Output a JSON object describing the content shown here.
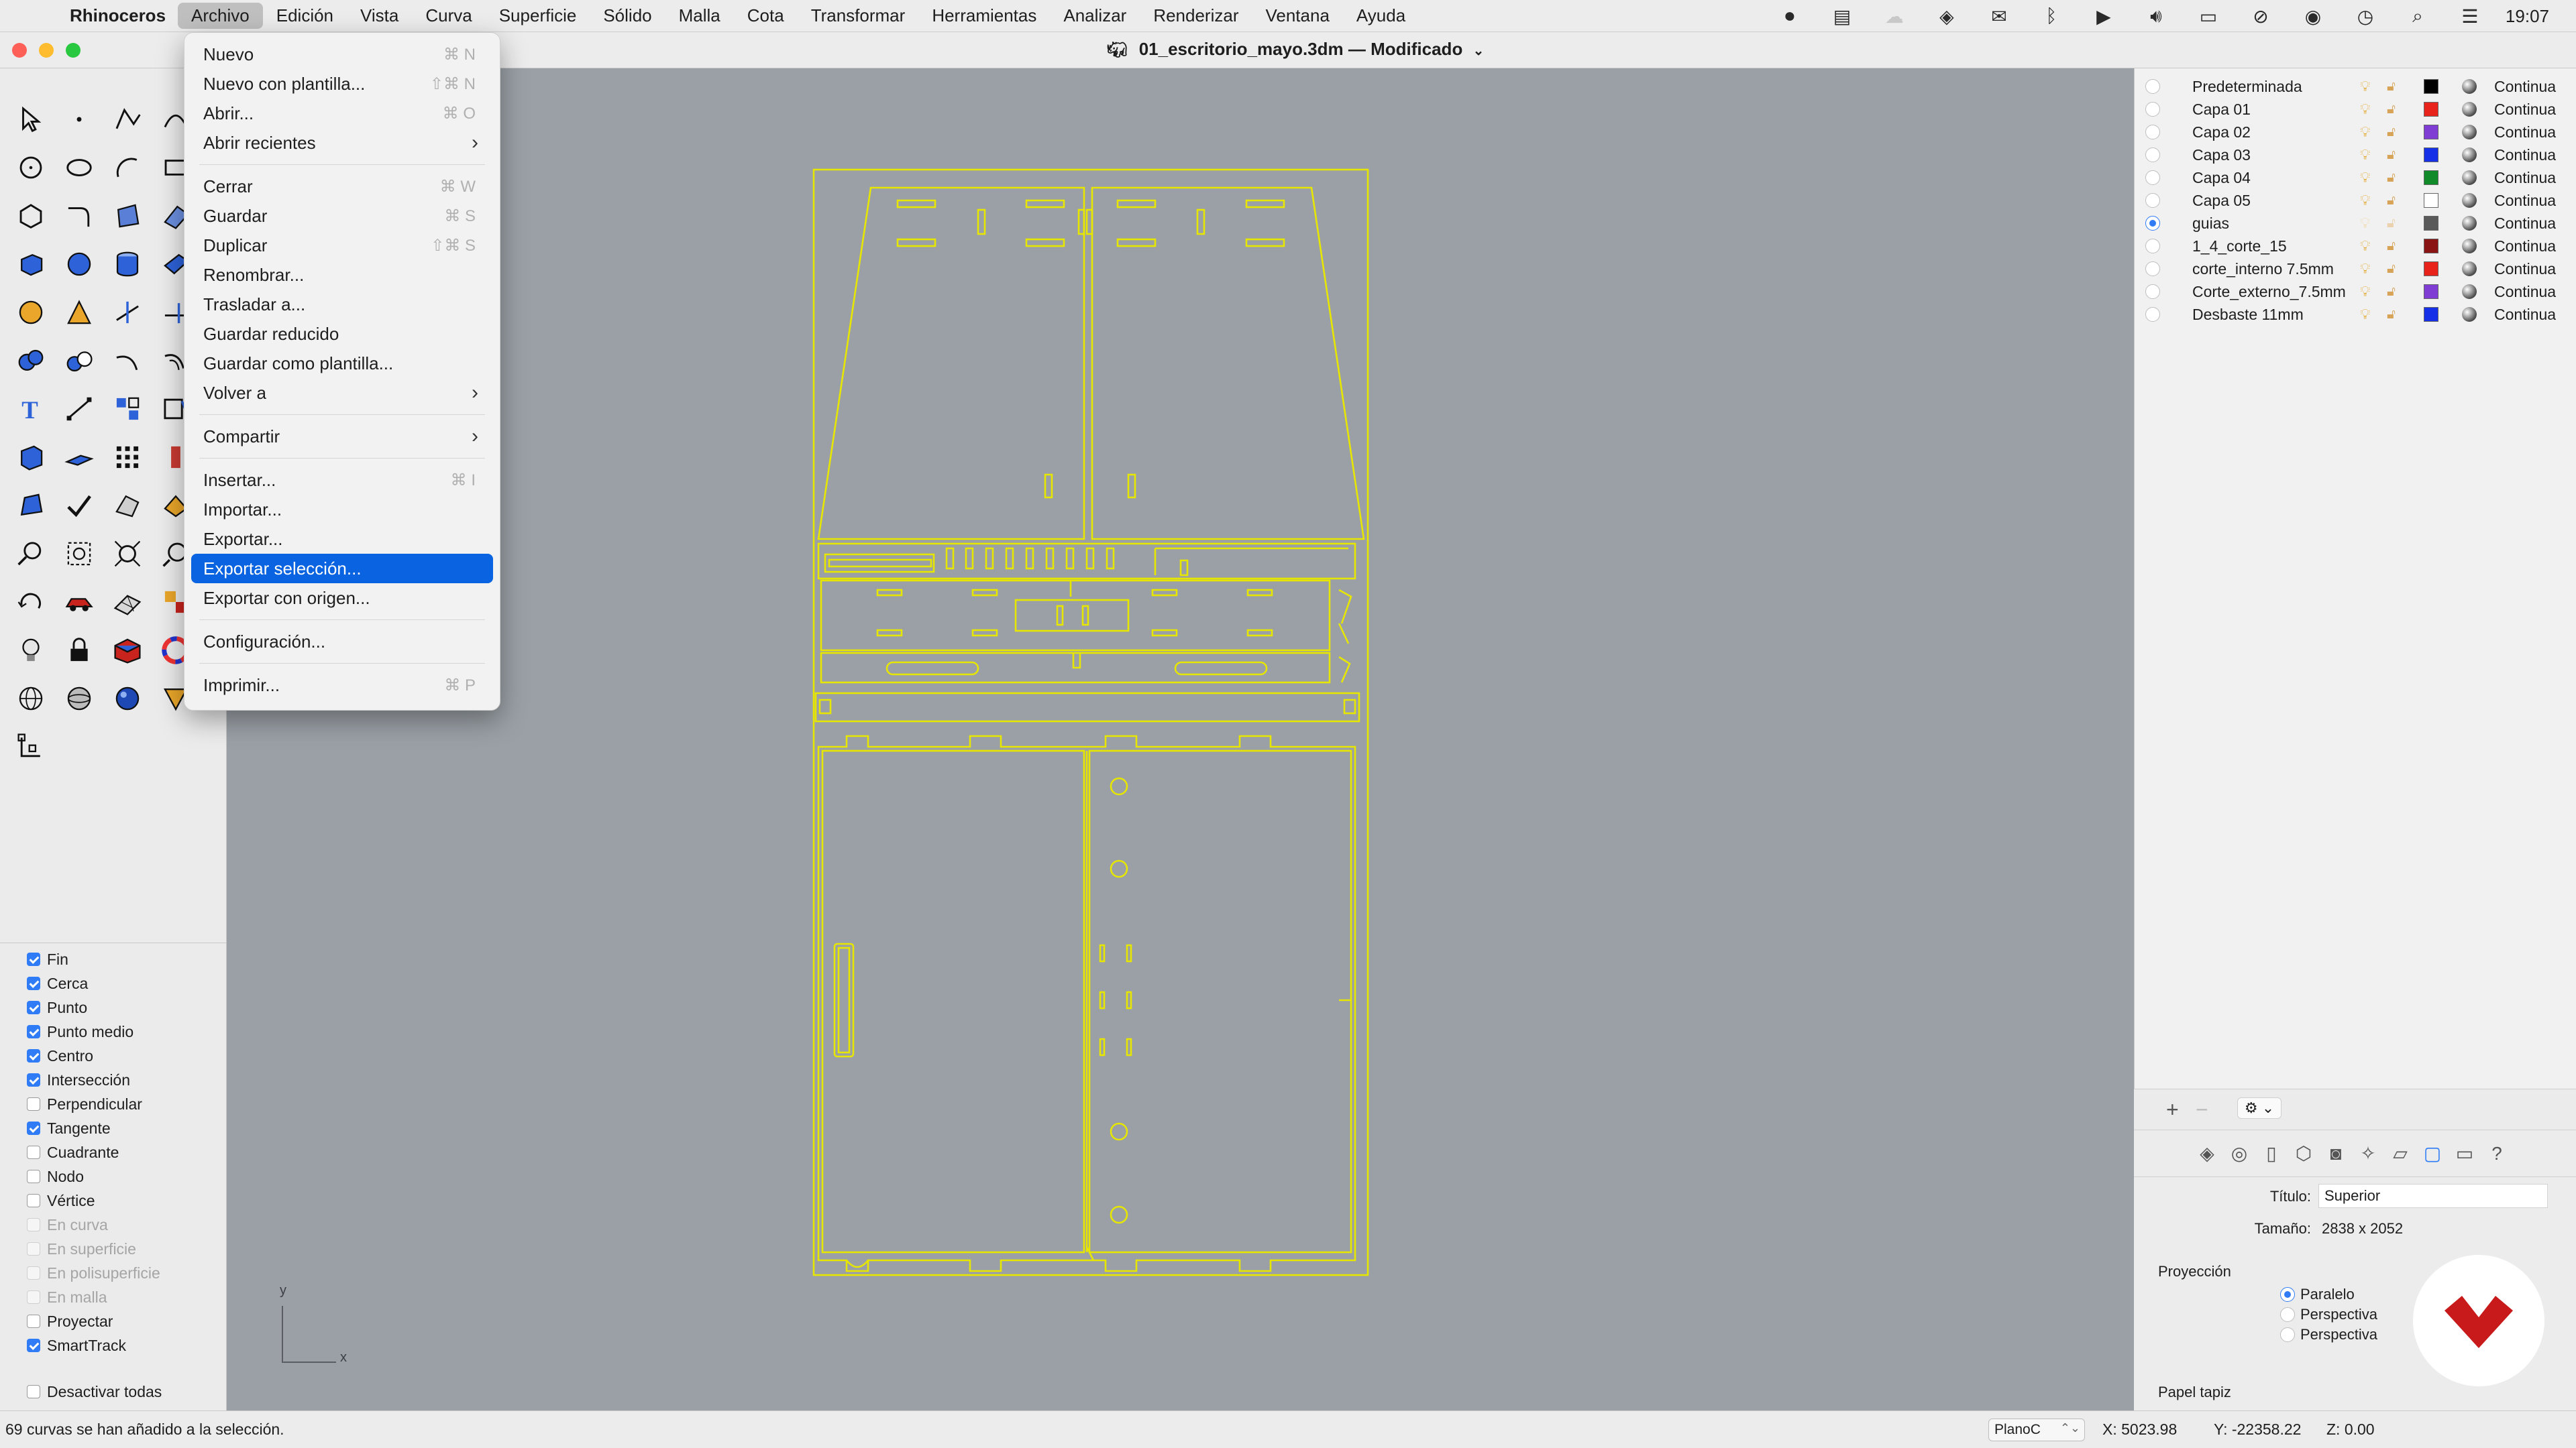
{
  "menubar": {
    "app_name": "Rhinoceros",
    "items": [
      "Archivo",
      "Edición",
      "Vista",
      "Curva",
      "Superficie",
      "Sólido",
      "Malla",
      "Cota",
      "Transformar",
      "Herramientas",
      "Analizar",
      "Renderizar",
      "Ventana",
      "Ayuda"
    ],
    "active_item": "Archivo",
    "clock": "19:07",
    "status_icons": [
      "record-icon",
      "notes-icon",
      "cloud-icon",
      "dropbox-icon",
      "mail-icon",
      "bluetooth-icon",
      "play-icon",
      "volume-icon",
      "battery-icon",
      "wifi-off-icon",
      "user-icon",
      "time-machine-icon",
      "search-icon",
      "control-center-icon"
    ]
  },
  "window": {
    "title": "01_escritorio_mayo.3dm",
    "separator": "—",
    "state": "Modificado"
  },
  "file_menu": {
    "items": [
      {
        "label": "Nuevo",
        "shortcut": "⌘ N"
      },
      {
        "label": "Nuevo con plantilla...",
        "shortcut": "⇧⌘ N"
      },
      {
        "label": "Abrir...",
        "shortcut": "⌘ O"
      },
      {
        "label": "Abrir recientes",
        "submenu": true
      },
      {
        "separator": true
      },
      {
        "label": "Cerrar",
        "shortcut": "⌘ W"
      },
      {
        "label": "Guardar",
        "shortcut": "⌘ S"
      },
      {
        "label": "Duplicar",
        "shortcut": "⇧⌘ S"
      },
      {
        "label": "Renombrar..."
      },
      {
        "label": "Trasladar a..."
      },
      {
        "label": "Guardar reducido"
      },
      {
        "label": "Guardar como plantilla..."
      },
      {
        "label": "Volver a",
        "submenu": true
      },
      {
        "separator": true
      },
      {
        "label": "Compartir",
        "submenu": true
      },
      {
        "separator": true
      },
      {
        "label": "Insertar...",
        "shortcut": "⌘ I"
      },
      {
        "label": "Importar..."
      },
      {
        "label": "Exportar..."
      },
      {
        "label": "Exportar selección...",
        "highlighted": true
      },
      {
        "label": "Exportar con origen..."
      },
      {
        "separator": true
      },
      {
        "label": "Configuración..."
      },
      {
        "separator": true
      },
      {
        "label": "Imprimir...",
        "shortcut": "⌘ P"
      }
    ]
  },
  "osnaps": {
    "items": [
      {
        "label": "Fin",
        "checked": true
      },
      {
        "label": "Cerca",
        "checked": true
      },
      {
        "label": "Punto",
        "checked": true
      },
      {
        "label": "Punto medio",
        "checked": true
      },
      {
        "label": "Centro",
        "checked": true
      },
      {
        "label": "Intersección",
        "checked": true
      },
      {
        "label": "Perpendicular",
        "checked": false
      },
      {
        "label": "Tangente",
        "checked": true
      },
      {
        "label": "Cuadrante",
        "checked": false
      },
      {
        "label": "Nodo",
        "checked": false
      },
      {
        "label": "Vértice",
        "checked": false
      },
      {
        "label": "En curva",
        "checked": false,
        "disabled": true
      },
      {
        "label": "En superficie",
        "checked": false,
        "disabled": true
      },
      {
        "label": "En polisuperficie",
        "checked": false,
        "disabled": true
      },
      {
        "label": "En malla",
        "checked": false,
        "disabled": true
      },
      {
        "label": "Proyectar",
        "checked": false
      },
      {
        "label": "SmartTrack",
        "checked": true
      }
    ],
    "disable_all": "Desactivar todas"
  },
  "layers": {
    "rows": [
      {
        "name": "Predeterminada",
        "color": "#000000",
        "linetype": "Continua",
        "current": false,
        "visible": true
      },
      {
        "name": "Capa 01",
        "color": "#e8231c",
        "linetype": "Continua",
        "current": false,
        "visible": true
      },
      {
        "name": "Capa 02",
        "color": "#7f3dd3",
        "linetype": "Continua",
        "current": false,
        "visible": true
      },
      {
        "name": "Capa 03",
        "color": "#1530e6",
        "linetype": "Continua",
        "current": false,
        "visible": true
      },
      {
        "name": "Capa 04",
        "color": "#118a2a",
        "linetype": "Continua",
        "current": false,
        "visible": true
      },
      {
        "name": "Capa 05",
        "color": "#ffffff",
        "linetype": "Continua",
        "current": false,
        "visible": true
      },
      {
        "name": "guias",
        "color": "#5a5a5a",
        "linetype": "Continua",
        "current": true,
        "visible": false
      },
      {
        "name": "1_4_corte_15",
        "color": "#8a1414",
        "linetype": "Continua",
        "current": false,
        "visible": true
      },
      {
        "name": "corte_interno 7.5mm",
        "color": "#e8231c",
        "linetype": "Continua",
        "current": false,
        "visible": true
      },
      {
        "name": "Corte_externo_7.5mm",
        "color": "#7f3dd3",
        "linetype": "Continua",
        "current": false,
        "visible": true
      },
      {
        "name": "Desbaste 11mm",
        "color": "#1530e6",
        "linetype": "Continua",
        "current": false,
        "visible": true
      }
    ]
  },
  "properties": {
    "title_label": "Título:",
    "title_value": "Superior",
    "size_label": "Tamaño:",
    "size_value": "2838 x 2052",
    "projection_label": "Proyección",
    "projection_options": [
      "Paralelo",
      "Perspectiva",
      "Perspectiva"
    ],
    "projection_selected": "Paralelo",
    "wallpaper_label": "Papel tapiz",
    "tab_icons": [
      "layers-icon",
      "material-icon",
      "document-icon",
      "object-icon",
      "camera-icon",
      "light-icon",
      "display-icon",
      "viewport-icon",
      "monitor-icon",
      "help-icon"
    ]
  },
  "statusbar": {
    "message": "69 curvas se han añadido a la selección.",
    "cplane": "PlanoC",
    "x": "X: 5023.98",
    "y": "Y: -22358.22",
    "z": "Z: 0.00"
  },
  "viewport": {
    "axis_x": "x",
    "axis_y": "y",
    "curve_color": "#e6e600"
  }
}
